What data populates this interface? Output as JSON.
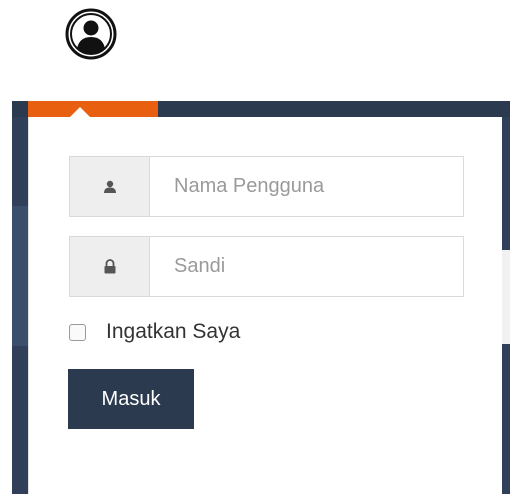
{
  "header": {
    "user_toggle_icon": "user-circle-icon"
  },
  "login_form": {
    "username": {
      "placeholder": "Nama Pengguna",
      "value": "",
      "icon": "user-icon"
    },
    "password": {
      "placeholder": "Sandi",
      "value": "",
      "icon": "lock-icon"
    },
    "remember_label": "Ingatkan Saya",
    "remember_checked": false,
    "submit_label": "Masuk"
  },
  "colors": {
    "navy": "#2b3a4f",
    "accent": "#e8600f"
  }
}
